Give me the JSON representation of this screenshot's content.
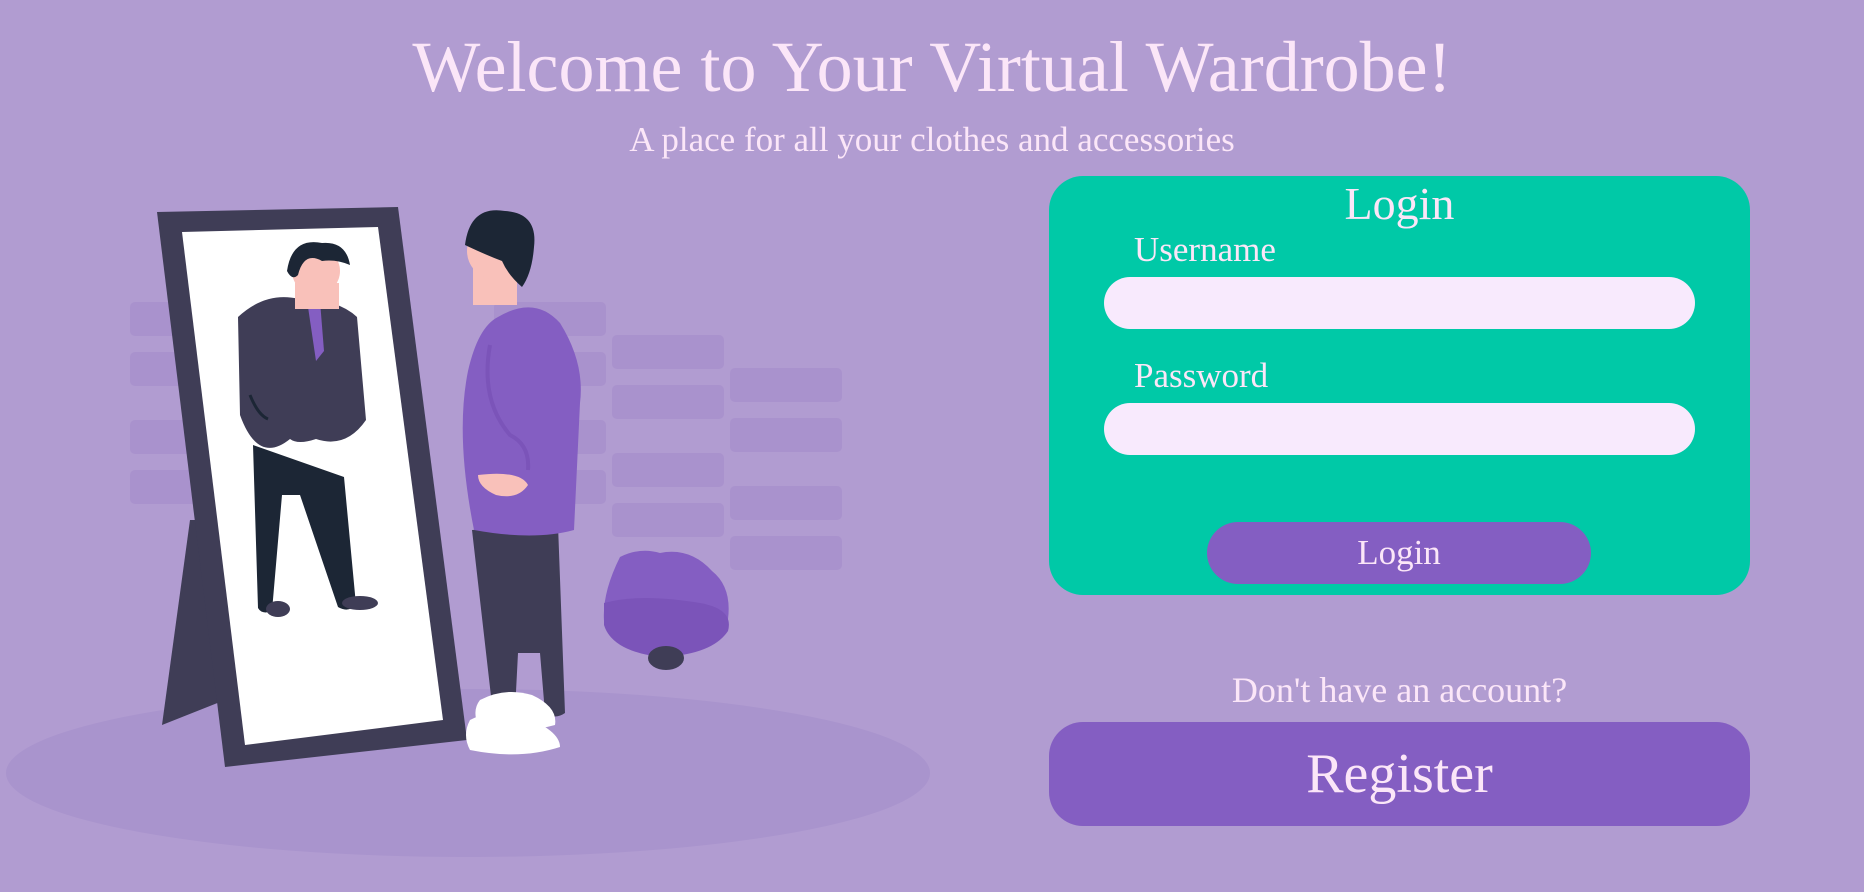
{
  "header": {
    "title": "Welcome to Your Virtual Wardrobe!",
    "subtitle": "A place for all your clothes and accessories"
  },
  "login": {
    "heading": "Login",
    "username_label": "Username",
    "username_value": "",
    "password_label": "Password",
    "password_value": "",
    "submit_label": "Login"
  },
  "register": {
    "prompt": "Don't have an account?",
    "button_label": "Register"
  },
  "illustration": {
    "subject": "person-looking-in-mirror-illustration"
  },
  "colors": {
    "background": "#b19cd1",
    "card": "#00c9a7",
    "accent": "#845ec2",
    "text": "#fbe6f8",
    "input": "#f8eafd"
  }
}
